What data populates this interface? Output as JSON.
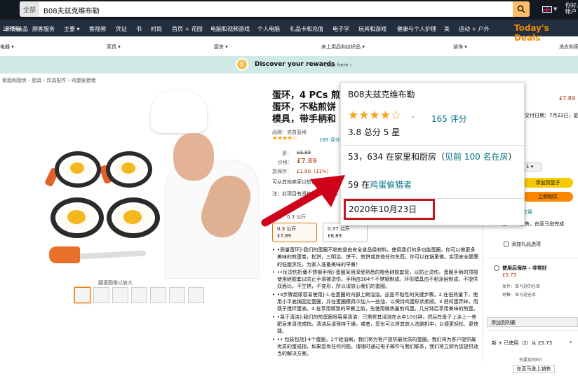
{
  "topbar": {
    "search_category": "全部",
    "search_query": "B08夫兹克维布勒",
    "greeting_line1": "你好，",
    "greeting_line2": "帐户"
  },
  "nav": {
    "items": [
      "所有",
      "新到商品",
      "顾客服务",
      "主要",
      "索视频",
      "凭证",
      "书",
      "时尚",
      "首页 + 花园",
      "电脑和视频游戏",
      "个人电脑",
      "礼品卡和充值",
      "电子学",
      "玩具和游戏",
      "健康与个人护理",
      "美",
      "运动 + 户外"
    ],
    "deals": "Today's Deals"
  },
  "subnav": {
    "items": [
      "电器",
      "家具",
      "厨房",
      "床上用品和纺织品",
      "装饰",
      "洗衣和家"
    ]
  },
  "rewards": {
    "text": "Discover your rewards",
    "link": "Click here"
  },
  "breadcrumb": "家庭和厨房 › 厨具 › 炊具配件 › 鸡蛋偷猎者",
  "gallery": {
    "zoom_hint": "翻滚图像以放大",
    "thumb_count": 7
  },
  "product": {
    "title": "蛋环，4 PCs 煎蛋环，不粘煎饼模具，带手柄和油刷，适用于煎蛋、鸡蛋三明治、煎饼，约克郡布丁",
    "brand": "品牌：克普蓝格",
    "stars": "★★★★☆",
    "ratings_count": "165 评分",
    "list_price_label": "是：",
    "list_price": "£8.89",
    "price_label": "价格：",
    "price": "£7.89",
    "saving_label": "您保存：",
    "saving": "£1.00（11%）",
    "lower_price_note": "可从其他卖家以较低的价格购买，这些卖家可能不会提供免费的 Prime 运输。",
    "note": "注：此项目有资格点击和收集。",
    "size_label": "尺寸：0.3 公斤",
    "options": [
      {
        "size": "0.3 公斤",
        "price": "£7.89"
      },
      {
        "size": "0.37 公斤",
        "price": "£8.89"
      }
    ],
    "bullets": [
      "•质量蛋环]-我们的蛋圈不粘煎是由安全食品级材料。使用我们的多功能蛋圈，你可以做更多美味的煎蛋卷，松饼，三明治，饼干，煎饼或其他任何东西，你可以在锅里做。实现安全健康的低脂烹饪，为家人准备美味的早餐！",
      "••反烫伤折叠不锈钢手柄]-蛋圈采用深受熟悉的橙色硅胶套管，以防止烫伤。蛋圈手柄的顶部使用硅胶套以防止手滑被烫伤。手柄由304个不锈钢制成。环形模具由不粘涂层制成，不提供双面比。不生锈，不变形，所以请放心我们的蛋圈。",
      "•4步骤超级容易使用]-1.在蛋圈的内部上刷油油。这是不粘性的关键步骤。2.在低热量下，使用小平底锅固定蛋圈，并在蛋圈模具中加入一些油，以保持鸡蛋形状柔顺。3.把鸡蛋弄碎，用筷子搅拌蛋液。4.在享用精致的早餐之前，先使用微热量煎鸡蛋。几分钟后享用美味的煎蛋。",
      "•易于清洁]-我们的煎蛋圈很容易清洁：只需将其浸泡在水中10分钟，然后在盘子上涂上一些肥皂来清洗戒指。清洁后请保持干燥。或者，您也可以将其放入洗碗机中，以便更轻松、更快捷。",
      "•• 包装包括]-4个蛋圈，1个硅油刷，我们将为客户提供最优质的蛋圈。我们将为客户提供最优质的蛋戒指，如果您有任何问题，请随时通过电子邮件与我们联系，我们将立即为您提供适当的解决方案。"
    ]
  },
  "buybox": {
    "price": "£7.89",
    "delivery": "交付日期：7月23日，星期",
    "qty_label": "1",
    "add_to_cart": "添加到篮子",
    "buy_now": "立即购买",
    "secure": "交易",
    "sold_by": "由FDEY出售，由亚马逊完成",
    "gift": "添加礼品选项",
    "used_title": "使用后保存 - 非常好",
    "used_price": "£5.73",
    "used_sold": "发件：亚马逊的仓库",
    "used_seller": "销售：亚马逊仓库",
    "add_list": "添加到列表",
    "new_used": "新 + 已使用（2）从 £5.73",
    "have_one": "有要卖的吗？",
    "sell_button": "在亚马逊上销售"
  },
  "popup": {
    "title": "B08夫兹克维布勒",
    "stars": "★★★★☆",
    "ratings": "165 评分",
    "average": "3.8 总分 5 星",
    "rank1_prefix": "53，634 在家里和厨房（",
    "rank1_link": "见前 100 名在房",
    "rank1_suffix": "）",
    "rank2_num": "59 在",
    "rank2_link": "鸡蛋偷猎者",
    "date": "2020年10月23日"
  },
  "colors": {
    "accent": "#c4161c",
    "nav_bg": "#232f3e",
    "top_bg": "#131921",
    "link": "#007185",
    "price": "#b12704"
  }
}
